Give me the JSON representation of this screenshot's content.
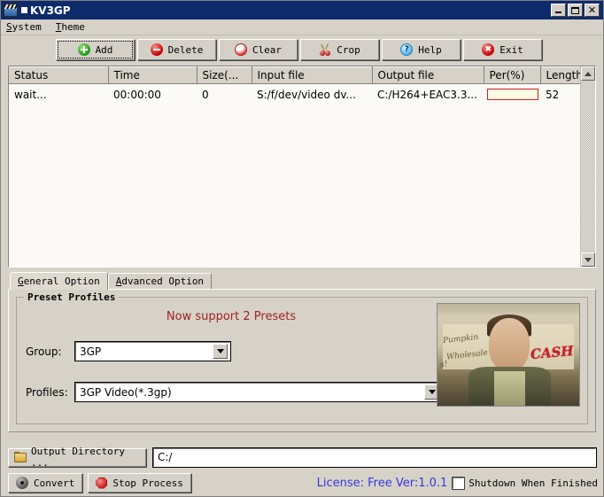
{
  "window": {
    "title": "KV3GP",
    "icon": "clapperboard-icon",
    "minimize_label": "",
    "maximize_label": "",
    "close_label": "✕"
  },
  "menubar": {
    "items": [
      {
        "label": "System",
        "accel": "S"
      },
      {
        "label": "Theme",
        "accel": "T"
      }
    ]
  },
  "toolbar": {
    "buttons": [
      {
        "label": "Add",
        "icon": "add-circle-icon"
      },
      {
        "label": "Delete",
        "icon": "delete-circle-icon"
      },
      {
        "label": "Clear",
        "icon": "clear-circle-icon"
      },
      {
        "label": "Crop",
        "icon": "scissors-icon"
      },
      {
        "label": "Help",
        "icon": "help-question-icon"
      },
      {
        "label": "Exit",
        "icon": "exit-x-icon"
      }
    ]
  },
  "filelist": {
    "columns": [
      "Status",
      "Time",
      "Size(...",
      "Input file",
      "Output file",
      "Per(%)",
      "Length"
    ],
    "rows": [
      {
        "status": "wait...",
        "time": "00:00:00",
        "size": "0",
        "input_file": "S:/f/dev/video dv...",
        "output_file": "C:/H264+EAC3.3...",
        "percent": "",
        "length": "52"
      }
    ]
  },
  "tabs": [
    {
      "label": "General Option",
      "accel": "G",
      "active": true
    },
    {
      "label": "Advanced Option",
      "accel": "A",
      "active": false
    }
  ],
  "general_option": {
    "groupbox_title": "Preset Profiles",
    "note": "Now support 2 Presets",
    "note_color": "#a02222",
    "group_label": "Group:",
    "group_value": "3GP",
    "profiles_label": "Profiles:",
    "profiles_value": "3GP Video(*.3gp)",
    "preview_caption": "CASH"
  },
  "output": {
    "button_label": "Output Directory ...",
    "button_icon": "folder-icon",
    "path_value": "C:/",
    "path_placeholder": ""
  },
  "bottom": {
    "convert_label": "Convert",
    "convert_icon": "film-reel-icon",
    "stop_label": "Stop Process",
    "stop_icon": "stop-octagon-icon",
    "license_text": "License: Free Ver:1.0.1",
    "license_color": "#3838e0",
    "shutdown_label": "Shutdown When Finished",
    "shutdown_checked": false
  }
}
